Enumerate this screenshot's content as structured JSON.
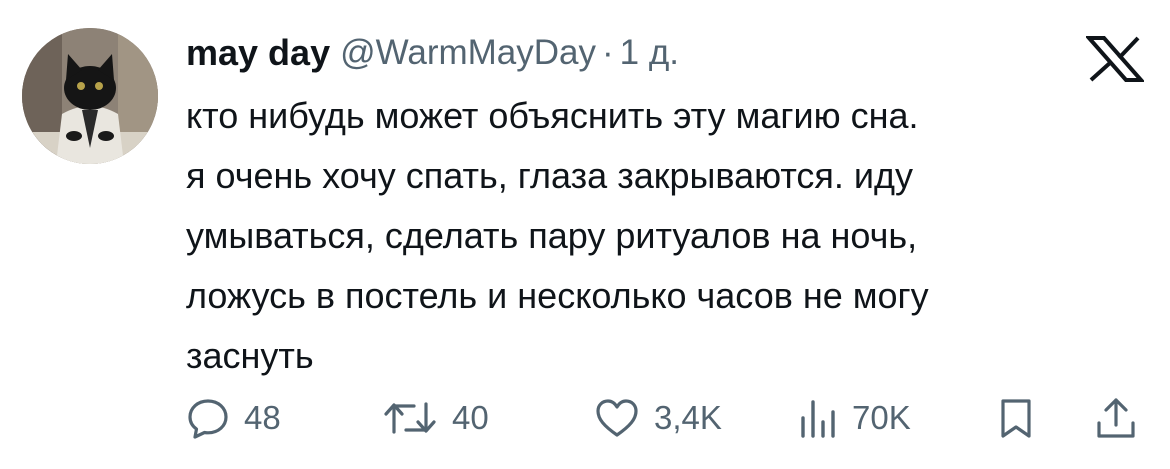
{
  "tweet": {
    "author": {
      "display_name": "may day",
      "handle": "@WarmMayDay",
      "avatar": "black-cat-in-lab-coat"
    },
    "separator": "·",
    "timestamp": "1 д.",
    "text_lines": [
      "кто нибудь может объяснить эту магию сна.",
      "я очень хочу спать, глаза закрываются. иду",
      "умываться, сделать пару ритуалов на ночь,",
      "ложусь в постель и несколько часов не могу",
      "заснуть"
    ],
    "platform_icon": "x-logo-icon",
    "actions": {
      "replies": "48",
      "retweets": "40",
      "likes": "3,4K",
      "views": "70K"
    }
  },
  "colors": {
    "text_primary": "#0f1419",
    "text_secondary": "#536471",
    "background": "#ffffff"
  }
}
